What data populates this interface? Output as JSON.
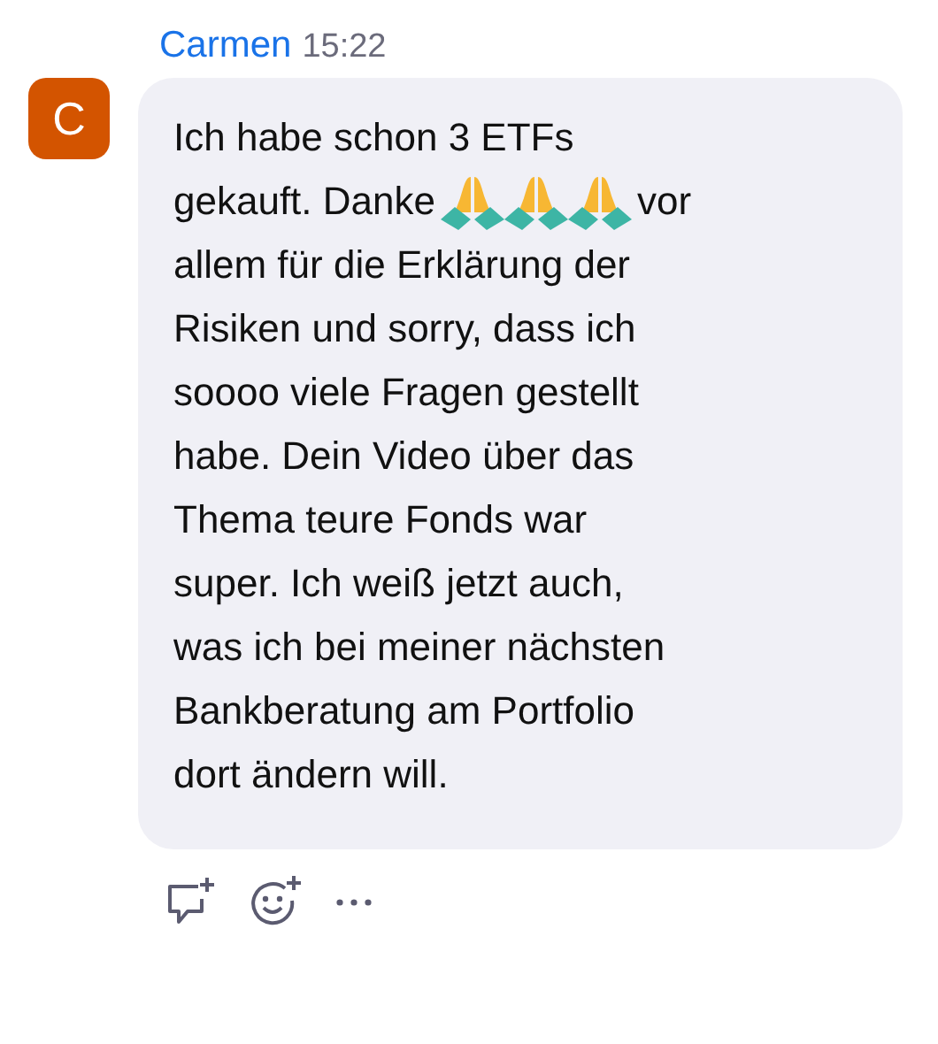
{
  "message": {
    "author": "Carmen",
    "time": "15:22",
    "avatar": {
      "letter": "C",
      "color": "#d35400"
    },
    "lines": [
      [
        {
          "kind": "text",
          "text": "Ich habe schon 3 ETFs"
        }
      ],
      [
        {
          "kind": "text",
          "text": "gekauft. Danke"
        },
        {
          "kind": "emoji"
        },
        {
          "kind": "emoji"
        },
        {
          "kind": "emoji"
        },
        {
          "kind": "text",
          "text": "vor"
        }
      ],
      [
        {
          "kind": "text",
          "text": "allem für die Erklärung der"
        }
      ],
      [
        {
          "kind": "text",
          "text": "Risiken und sorry, dass ich"
        }
      ],
      [
        {
          "kind": "text",
          "text": "soooo viele Fragen gestellt"
        }
      ],
      [
        {
          "kind": "text",
          "text": "habe. Dein Video über das"
        }
      ],
      [
        {
          "kind": "text",
          "text": "Thema teure Fonds war"
        }
      ],
      [
        {
          "kind": "text",
          "text": "super. Ich weiß jetzt auch,"
        }
      ],
      [
        {
          "kind": "text",
          "text": "was ich bei meiner nächsten"
        }
      ],
      [
        {
          "kind": "text",
          "text": "Bankberatung am Portfolio"
        }
      ],
      [
        {
          "kind": "text",
          "text": "dort ändern will."
        }
      ]
    ]
  },
  "actions": [
    {
      "kind": "reply"
    },
    {
      "kind": "react"
    },
    {
      "kind": "more"
    }
  ]
}
